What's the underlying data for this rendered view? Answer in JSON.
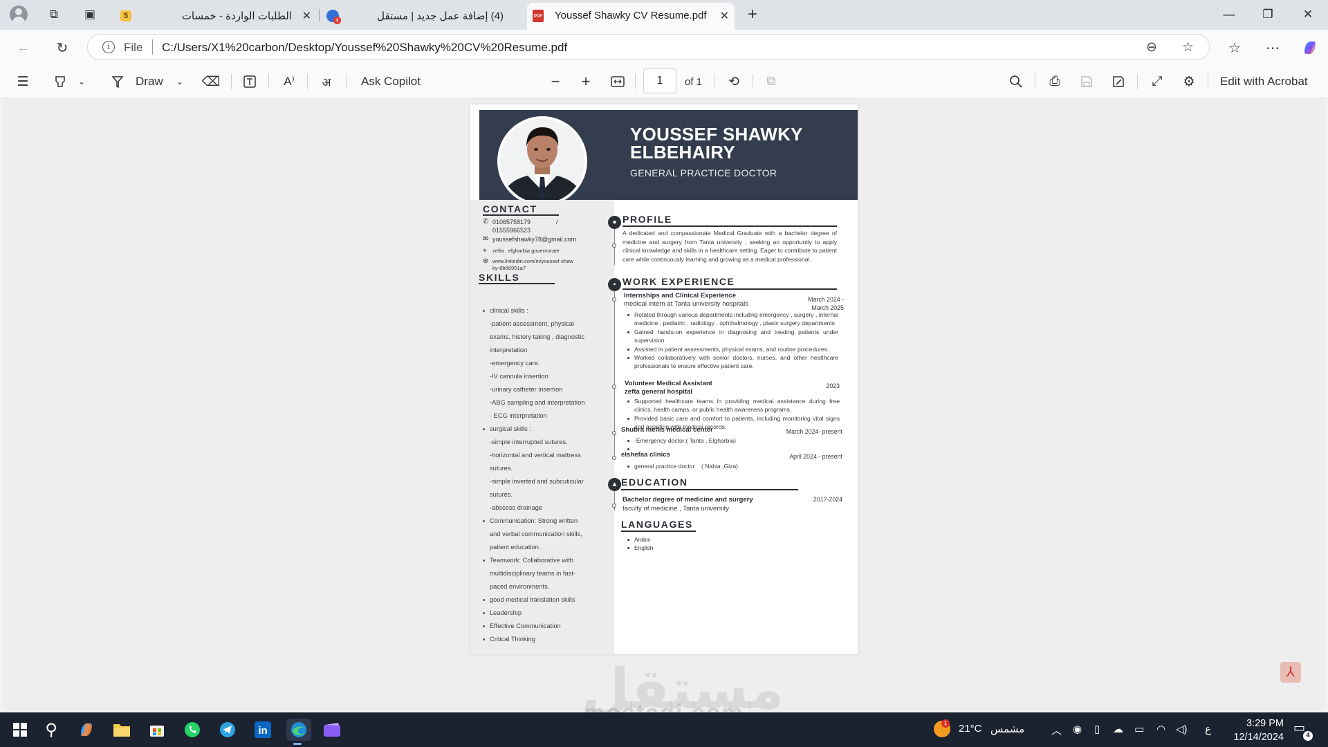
{
  "browser": {
    "tabs": [
      {
        "title": "الطلبات الواردة - خمسات",
        "badge": "5"
      },
      {
        "title": "(4) إضافة عمل جديد | مستقل"
      },
      {
        "title": "Youssef Shawky CV Resume.pdf",
        "favicon": "PDF"
      }
    ],
    "address": {
      "scheme_label": "File",
      "url": "C:/Users/X1%20carbon/Desktop/Youssef%20Shawky%20CV%20Resume.pdf"
    }
  },
  "pdf_toolbar": {
    "draw_label": "Draw",
    "copilot_label": "Ask Copilot",
    "page_current": "1",
    "page_of": "of 1",
    "acrobat_label": "Edit with Acrobat"
  },
  "cv": {
    "name": "YOUSSEF SHAWKY ELBEHAIRY",
    "role": "GENERAL PRACTICE DOCTOR",
    "contact_heading": "CONTACT",
    "contact": {
      "phone": "01065758179",
      "phone_sep": "/",
      "phone2": "01555966523",
      "email": "youssefshawky78@gmail.com",
      "location": "zefta , elgharbia governorate",
      "linkedin": "www.linkedin.com/in/youssef-shawky-8b66951a7"
    },
    "skills_heading": "SKILLS",
    "skills": [
      {
        "type": "bullet",
        "text": "clinical skills :"
      },
      {
        "type": "sub",
        "text": "-patient assessment, physical"
      },
      {
        "type": "sub",
        "text": "exams, history taking , diagnostic"
      },
      {
        "type": "sub",
        "text": "interpretation"
      },
      {
        "type": "sub",
        "text": "-emergency care."
      },
      {
        "type": "sub",
        "text": "-IV cannula insertion"
      },
      {
        "type": "sub",
        "text": "-urinary catheter insertion"
      },
      {
        "type": "sub",
        "text": "-ABG sampling and interpretation"
      },
      {
        "type": "sub",
        "text": "- ECG interpretation"
      },
      {
        "type": "bullet",
        "text": "surgical skills :"
      },
      {
        "type": "sub",
        "text": "-simple interrupted sutures."
      },
      {
        "type": "sub",
        "text": "-horizontal and vertical mattress"
      },
      {
        "type": "sub",
        "text": "sutures."
      },
      {
        "type": "sub",
        "text": "-simple inverted and subcuticular"
      },
      {
        "type": "sub",
        "text": "sutures."
      },
      {
        "type": "sub",
        "text": "-abscess drainage"
      },
      {
        "type": "bullet",
        "text": "Communication: Strong written"
      },
      {
        "type": "sub",
        "text": "and verbal communication skills,"
      },
      {
        "type": "sub",
        "text": "patient education."
      },
      {
        "type": "bullet",
        "text": "Teamwork: Collaborative with"
      },
      {
        "type": "sub",
        "text": "multidisciplinary teams in fast-"
      },
      {
        "type": "sub",
        "text": "paced environments."
      },
      {
        "type": "bullet",
        "text": "good medical translation skills"
      },
      {
        "type": "bullet",
        "text": "Leadership"
      },
      {
        "type": "bullet",
        "text": "Effective Communication"
      },
      {
        "type": "bullet",
        "text": "Critical Thinking"
      }
    ],
    "profile_heading": "PROFILE",
    "profile_text": "A dedicated and compassionate Medical Graduate with a bachelor degree of medicine and surgery from Tanta university , seeking an opportunity to apply clinical knowledge and skills in a healthcare setting. Eager to contribute to patient care while continuously learning and growing as a medical professional.",
    "work_heading": "WORK EXPERIENCE",
    "work": [
      {
        "title": "Internships and Clinical Experience",
        "subtitle": "medical intern at Tanta university hospitals",
        "date": "March 2024 -",
        "date2": "March 2025",
        "bullets": [
          "Rotated through various departments including emergency , surgery , internal medicine , pediatric , radiology , ophthalmology , plastc surgery departments",
          "Gained hands-on experience in diagnosing and treating patients under supervision.",
          "Assisted in patient assessments, physical exams, and routine procedures.",
          "Worked collaboratively with senior doctors, nurses, and other healthcare professionals to ensure effective patient care."
        ]
      },
      {
        "title": "Volunteer Medical Assistant",
        "subtitle": "zefta general hospital",
        "date": "2023",
        "bullets": [
          "Supported healthcare teams in providing medical assistance during free clinics, health camps, or public health awareness programs.",
          "Provided basic care and comfort to patients, including monitoring vital signs and assisting with medical records."
        ]
      },
      {
        "title": "Shubra mellis medical center",
        "date": "March 2024- present",
        "bullets": [
          "-Emergency doctor.( Tanta , Elgharbia)",
          ""
        ]
      },
      {
        "title": "elshefaa clinics",
        "date": "April 2024 - present",
        "bullets": [
          "general practice doctor    ( Nahia ,Giza)"
        ]
      }
    ],
    "education_heading": "EDUCATION",
    "education": {
      "degree": "Bachelor degree of medicine and surgery",
      "school": "faculty of medicine , Tanta university",
      "date": "2017-2024"
    },
    "languages_heading": "LANGUAGES",
    "languages": [
      "Arabic",
      "English"
    ]
  },
  "watermark": {
    "arabic": "مستقل",
    "latin": "mostaqi.com"
  },
  "taskbar": {
    "weather_temp": "21°C",
    "weather_label": "مشمس",
    "weather_badge": "1",
    "lang": "ع",
    "time": "3:29 PM",
    "date": "12/14/2024",
    "notif_count": "4"
  }
}
